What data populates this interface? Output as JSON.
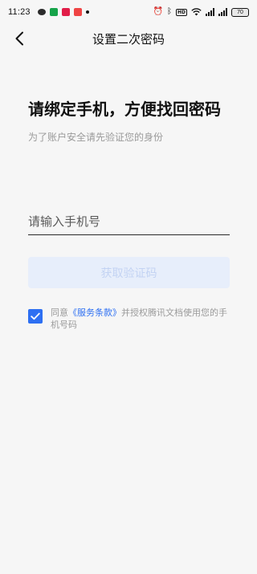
{
  "status_bar": {
    "time": "11:23",
    "battery": "70",
    "hd": "HD"
  },
  "nav": {
    "title": "设置二次密码"
  },
  "main": {
    "headline": "请绑定手机，方便找回密码",
    "subhint": "为了账户安全请先验证您的身份",
    "phone_placeholder": "请输入手机号",
    "get_code_label": "获取验证码"
  },
  "agreement": {
    "prefix": "同意",
    "link": "《服务条款》",
    "suffix": "并授权腾讯文档使用您的手机号码",
    "checked": true
  },
  "colors": {
    "accent": "#2d6ff2",
    "button_bg": "#e7eefb",
    "button_text": "#c3d3f3",
    "background": "#f6f6f6"
  },
  "icons": {
    "back": "chevron-left-icon",
    "check": "check-icon",
    "alarm": "alarm-icon",
    "wifi": "wifi-icon",
    "signal": "signal-icon",
    "battery": "battery-icon"
  }
}
